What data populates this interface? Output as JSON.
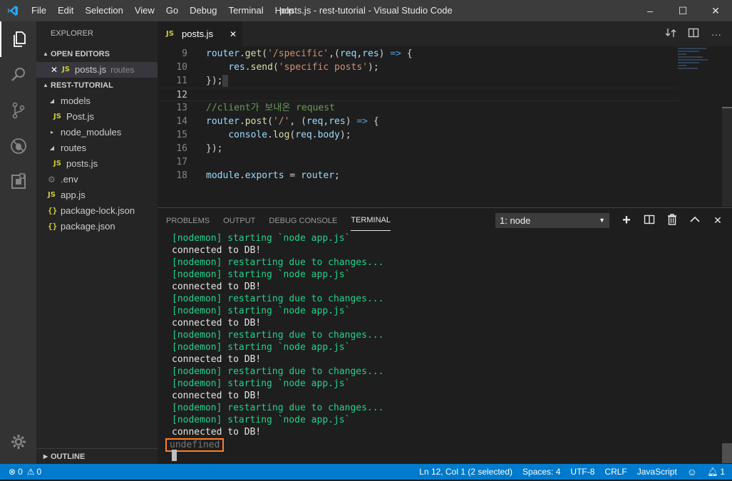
{
  "titlebar": {
    "menu": [
      "File",
      "Edit",
      "Selection",
      "View",
      "Go",
      "Debug",
      "Terminal",
      "Help"
    ],
    "title": "posts.js - rest-tutorial - Visual Studio Code",
    "minimize": "–",
    "maximize": "☐",
    "close": "✕"
  },
  "sidebar": {
    "header": "EXPLORER",
    "open_editors": {
      "label": "OPEN EDITORS",
      "items": [
        {
          "name": "posts.js",
          "folder": "routes"
        }
      ]
    },
    "project": {
      "label": "REST-TUTORIAL",
      "tree": [
        {
          "name": "models",
          "kind": "folder-open"
        },
        {
          "name": "Post.js",
          "kind": "js"
        },
        {
          "name": "node_modules",
          "kind": "folder-closed"
        },
        {
          "name": "routes",
          "kind": "folder-open"
        },
        {
          "name": "posts.js",
          "kind": "js"
        },
        {
          "name": ".env",
          "kind": "env"
        },
        {
          "name": "app.js",
          "kind": "js"
        },
        {
          "name": "package-lock.json",
          "kind": "json"
        },
        {
          "name": "package.json",
          "kind": "json"
        }
      ]
    },
    "outline": "OUTLINE"
  },
  "tabs": {
    "active": {
      "name": "posts.js",
      "badge": "JS",
      "close": "✕"
    }
  },
  "editor": {
    "lines": [
      {
        "n": "9",
        "tokens": [
          [
            "router",
            "k-var"
          ],
          [
            ".",
            "k-pun"
          ],
          [
            "get",
            "k-fn"
          ],
          [
            "(",
            "k-pun"
          ],
          [
            "'/specific'",
            "k-str"
          ],
          [
            ",(",
            "k-pun"
          ],
          [
            "req",
            "k-var"
          ],
          [
            ",",
            "k-pun"
          ],
          [
            "res",
            "k-var"
          ],
          [
            ") ",
            "k-pun"
          ],
          [
            "=>",
            "k-kw"
          ],
          [
            " {",
            "k-pun"
          ]
        ]
      },
      {
        "n": "10",
        "tokens": [
          [
            "    ",
            "k-pun"
          ],
          [
            "res",
            "k-var"
          ],
          [
            ".",
            "k-pun"
          ],
          [
            "send",
            "k-fn"
          ],
          [
            "(",
            "k-pun"
          ],
          [
            "'specific posts'",
            "k-str"
          ],
          [
            ");",
            "k-pun"
          ]
        ]
      },
      {
        "n": "11",
        "tokens": [
          [
            "});",
            "k-pun"
          ]
        ]
      },
      {
        "n": "12",
        "tokens": []
      },
      {
        "n": "13",
        "tokens": [
          [
            "//client가 보내온 request",
            "k-com"
          ]
        ]
      },
      {
        "n": "14",
        "tokens": [
          [
            "router",
            "k-var"
          ],
          [
            ".",
            "k-pun"
          ],
          [
            "post",
            "k-fn"
          ],
          [
            "(",
            "k-pun"
          ],
          [
            "'/'",
            "k-str"
          ],
          [
            ", (",
            "k-pun"
          ],
          [
            "req",
            "k-var"
          ],
          [
            ",",
            "k-pun"
          ],
          [
            "res",
            "k-var"
          ],
          [
            ") ",
            "k-pun"
          ],
          [
            "=>",
            "k-kw"
          ],
          [
            " {",
            "k-pun"
          ]
        ]
      },
      {
        "n": "15",
        "tokens": [
          [
            "    ",
            "k-pun"
          ],
          [
            "console",
            "k-var"
          ],
          [
            ".",
            "k-pun"
          ],
          [
            "log",
            "k-fn"
          ],
          [
            "(",
            "k-pun"
          ],
          [
            "req",
            "k-var"
          ],
          [
            ".",
            "k-pun"
          ],
          [
            "body",
            "k-var"
          ],
          [
            ");",
            "k-pun"
          ]
        ]
      },
      {
        "n": "16",
        "tokens": [
          [
            "});",
            "k-pun"
          ]
        ]
      },
      {
        "n": "17",
        "tokens": []
      },
      {
        "n": "18",
        "tokens": [
          [
            "module",
            "k-var"
          ],
          [
            ".",
            "k-pun"
          ],
          [
            "exports",
            "k-var"
          ],
          [
            " = ",
            "k-op"
          ],
          [
            "router",
            "k-var"
          ],
          [
            ";",
            "k-pun"
          ]
        ]
      }
    ],
    "current_line": "12"
  },
  "panel": {
    "tabs": [
      "PROBLEMS",
      "OUTPUT",
      "DEBUG CONSOLE",
      "TERMINAL"
    ],
    "active_tab": "TERMINAL",
    "terminal_select": "1: node",
    "terminal_lines": [
      {
        "text": "[nodemon] starting `node app.js`",
        "color": "green"
      },
      {
        "text": "connected to DB!",
        "color": "white"
      },
      {
        "text": "[nodemon] restarting due to changes...",
        "color": "green"
      },
      {
        "text": "[nodemon] starting `node app.js`",
        "color": "green"
      },
      {
        "text": "connected to DB!",
        "color": "white"
      },
      {
        "text": "[nodemon] restarting due to changes...",
        "color": "green"
      },
      {
        "text": "[nodemon] starting `node app.js`",
        "color": "green"
      },
      {
        "text": "connected to DB!",
        "color": "white"
      },
      {
        "text": "[nodemon] restarting due to changes...",
        "color": "green"
      },
      {
        "text": "[nodemon] starting `node app.js`",
        "color": "green"
      },
      {
        "text": "connected to DB!",
        "color": "white"
      },
      {
        "text": "[nodemon] restarting due to changes...",
        "color": "green"
      },
      {
        "text": "[nodemon] starting `node app.js`",
        "color": "green"
      },
      {
        "text": "connected to DB!",
        "color": "white"
      },
      {
        "text": "[nodemon] restarting due to changes...",
        "color": "green"
      },
      {
        "text": "[nodemon] starting `node app.js`",
        "color": "green"
      },
      {
        "text": "connected to DB!",
        "color": "white"
      }
    ],
    "highlighted_output": "undefined"
  },
  "statusbar": {
    "errors": "0",
    "warnings": "0",
    "position": "Ln 12, Col 1 (2 selected)",
    "spaces": "Spaces: 4",
    "encoding": "UTF-8",
    "eol": "CRLF",
    "language": "JavaScript",
    "notifications": "1"
  },
  "colors": {
    "accent": "#007acc",
    "highlight_box": "#ff7f27",
    "terminal_green": "#23d18b"
  }
}
